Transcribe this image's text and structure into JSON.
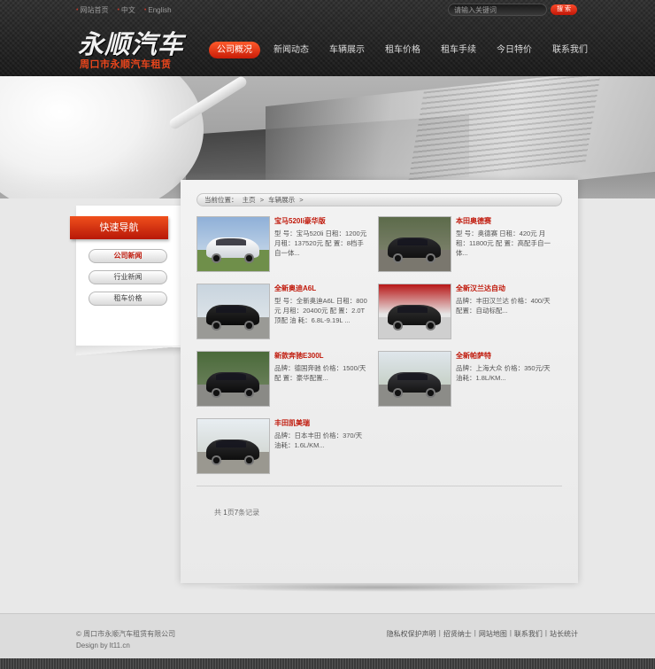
{
  "top_links": [
    {
      "label": "网站首页"
    },
    {
      "label": "中文"
    },
    {
      "label": "English"
    }
  ],
  "search": {
    "placeholder": "请输入关键词",
    "button": "搜 索"
  },
  "logo": {
    "title": "永顺汽车",
    "subtitle": "周口市永顺汽车租赁"
  },
  "nav": [
    {
      "label": "公司概况",
      "active": true
    },
    {
      "label": "新闻动态"
    },
    {
      "label": "车辆展示"
    },
    {
      "label": "租车价格"
    },
    {
      "label": "租车手续"
    },
    {
      "label": "今日特价"
    },
    {
      "label": "联系我们"
    }
  ],
  "sidebar": {
    "title": "快速导航",
    "items": [
      {
        "label": "公司新闻",
        "active": true
      },
      {
        "label": "行业新闻"
      },
      {
        "label": "租车价格"
      }
    ]
  },
  "breadcrumb": {
    "prefix": "当前位置：",
    "home": "主页",
    "sep1": ">",
    "current": "车辆展示",
    "sep2": ">"
  },
  "cars": [
    {
      "name": "宝马520li豪华版",
      "desc": "型 号：宝马520li 日租：1200元 月租：137520元 配 置：8档手自一体..."
    },
    {
      "name": "本田奥德赛",
      "desc": "型 号：奥德赛 日租：420元 月租：11800元 配 置：高配手自一体..."
    },
    {
      "name": "全新奥迪A6L",
      "desc": "型 号：全新奥迪A6L 日租：800元 月租：20400元 配 置：2.0T顶配 油 耗：6.8L-9.19L ..."
    },
    {
      "name": "全新汉兰达自动",
      "desc": "品牌：丰田汉兰达 价格：400/天 配置：自动标配..."
    },
    {
      "name": "新款奔驰E300L",
      "desc": "品牌：德国奔驰 价格：1500/天 配 置：豪华配置..."
    },
    {
      "name": "全新帕萨特",
      "desc": "品牌：上海大众 价格：350元/天 油耗：1.8L/KM..."
    },
    {
      "name": "丰田凯美瑞",
      "desc": "品牌：日本丰田 价格：370/天 油耗：1.6L/KM..."
    }
  ],
  "pager": {
    "pre": "共",
    "pages": "1",
    "mid": "页",
    "count": "7",
    "post": "条记录"
  },
  "footer": {
    "copyright": "© 周口市永顺汽车租赁有限公司",
    "design": "Design by lt11.cn",
    "links": [
      "隐私权保护声明",
      "招贤纳士",
      "网站地图",
      "联系我们",
      "站长统计"
    ]
  },
  "colors": {
    "accent": "#e8451c",
    "link_red": "#c0180a",
    "header_bg": "#2a2a2a"
  }
}
